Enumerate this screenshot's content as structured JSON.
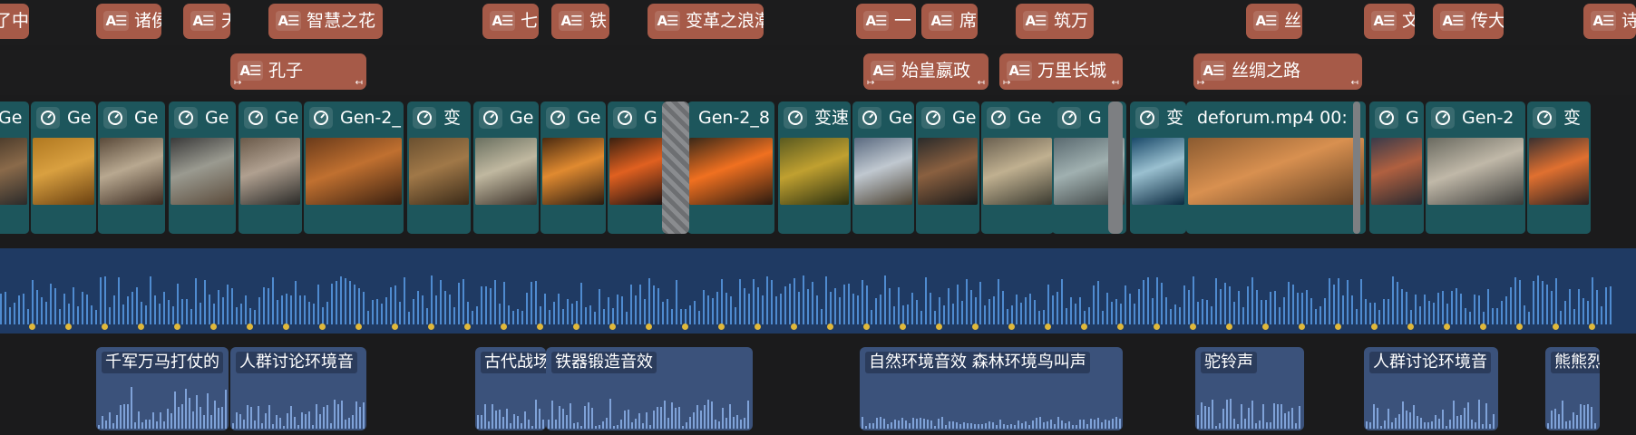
{
  "colors": {
    "background": "#1b1b1c",
    "text_clip": "#a65a48",
    "video_clip": "#1d565c",
    "audio_lane": "#1f3a63",
    "audio_clip": "#3b527b",
    "marker": "#e0b83a"
  },
  "text_icon_label": "A☰",
  "text_track_1": [
    {
      "label": "了中华",
      "icon": "text-icon"
    },
    {
      "label": "诸侯",
      "icon": "text-icon"
    },
    {
      "label": "天",
      "icon": "text-icon"
    },
    {
      "label": "智慧之花",
      "icon": "text-icon"
    },
    {
      "label": "七",
      "icon": "text-icon"
    },
    {
      "label": "铁",
      "icon": "text-icon"
    },
    {
      "label": "变革之浪潮",
      "icon": "text-icon"
    },
    {
      "label": "一",
      "icon": "text-icon"
    },
    {
      "label": "席",
      "icon": "text-icon"
    },
    {
      "label": "筑万",
      "icon": "text-icon"
    },
    {
      "label": "丝",
      "icon": "text-icon"
    },
    {
      "label": "文",
      "icon": "text-icon"
    },
    {
      "label": "传大",
      "icon": "text-icon"
    },
    {
      "label": "诗",
      "icon": "text-icon"
    }
  ],
  "text_track_2": [
    {
      "label": "孔子",
      "icon": "text-icon"
    },
    {
      "label": "始皇嬴政",
      "icon": "text-icon"
    },
    {
      "label": "万里长城",
      "icon": "text-icon"
    },
    {
      "label": "丝绸之路",
      "icon": "text-icon"
    }
  ],
  "video_track": [
    {
      "label": "Ge",
      "icon": "speed-icon"
    },
    {
      "label": "Ge",
      "icon": "speed-icon"
    },
    {
      "label": "Ge",
      "icon": "speed-icon"
    },
    {
      "label": "Ge",
      "icon": "speed-icon"
    },
    {
      "label": "Ge",
      "icon": "speed-icon"
    },
    {
      "label": "Gen-2_",
      "icon": "speed-icon"
    },
    {
      "label": "变",
      "icon": "speed-icon"
    },
    {
      "label": "Ge",
      "icon": "speed-icon"
    },
    {
      "label": "Ge",
      "icon": "speed-icon"
    },
    {
      "label": "G",
      "icon": "speed-icon"
    },
    {
      "label": "Gen-2_8",
      "icon": ""
    },
    {
      "label": "变速",
      "icon": "speed-icon"
    },
    {
      "label": "Ge",
      "icon": "speed-icon"
    },
    {
      "label": "Ge",
      "icon": "speed-icon"
    },
    {
      "label": "Ge",
      "icon": "speed-icon"
    },
    {
      "label": "G",
      "icon": "speed-icon"
    },
    {
      "label": "变",
      "icon": "speed-icon"
    },
    {
      "label": "deforum.mp4    00:",
      "icon": ""
    },
    {
      "label": "G",
      "icon": "speed-icon"
    },
    {
      "label": "Gen-2",
      "icon": "speed-icon"
    },
    {
      "label": "变",
      "icon": "speed-icon"
    }
  ],
  "sfx_track": [
    {
      "label": "千军万马打仗的"
    },
    {
      "label": "人群讨论环境音"
    },
    {
      "label": "古代战场"
    },
    {
      "label": "铁器锻造音效"
    },
    {
      "label": "自然环境音效 森林环境鸟叫声"
    },
    {
      "label": "驼铃声"
    },
    {
      "label": "人群讨论环境音"
    },
    {
      "label": "熊熊烈火"
    }
  ]
}
